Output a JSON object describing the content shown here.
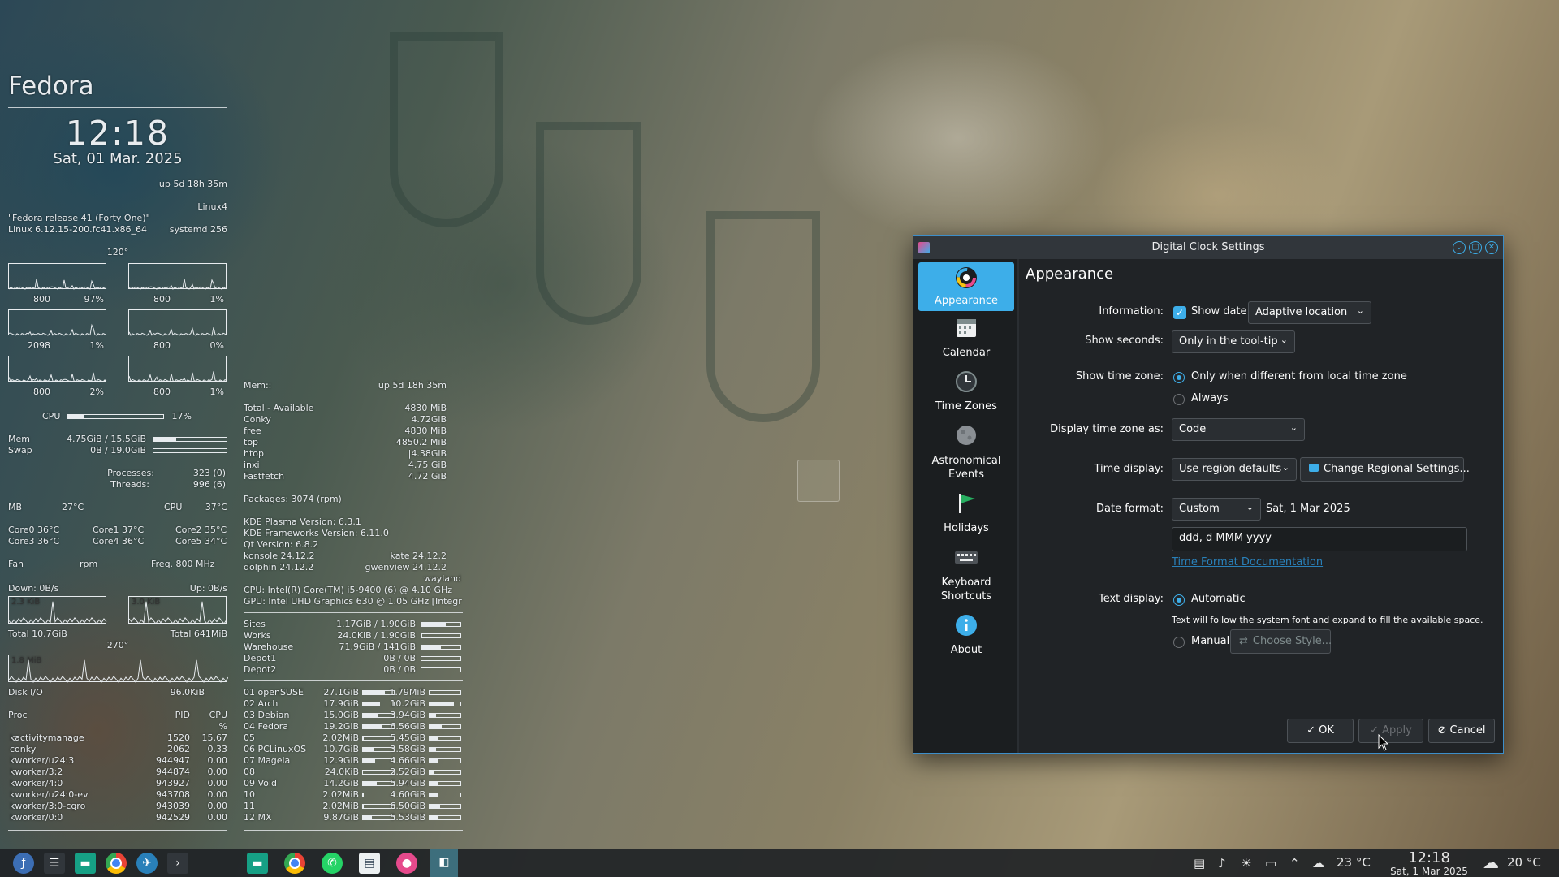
{
  "colors": {
    "accent": "#3daee9",
    "window_bg": "#202326",
    "sidebar_bg": "#1b1e20"
  },
  "conky_left": {
    "distro": "Fedora",
    "time": "12:18",
    "date": "Sat, 01 Mar. 2025",
    "uptime": "up  5d 18h 35m",
    "kernel_name": "Linux4",
    "release": "\"Fedora release 41 (Forty One)\"",
    "kernel": "Linux 6.12.15-200.fc41.x86_64",
    "systemd": "systemd 256",
    "temp_top": "120°",
    "cpu_graphs": [
      {
        "freq": "800",
        "pct": "97%"
      },
      {
        "freq": "800",
        "pct": "1%"
      },
      {
        "freq": "2098",
        "pct": "1%"
      },
      {
        "freq": "800",
        "pct": "0%"
      },
      {
        "freq": "800",
        "pct": "2%"
      },
      {
        "freq": "800",
        "pct": "1%"
      }
    ],
    "cpu_label": "CPU",
    "cpu_pct": "17%",
    "cpu_fill": 0.17,
    "mem_label": "Mem",
    "mem_val": "4.75GiB / 15.5GiB",
    "mem_fill": 0.31,
    "swap_label": "Swap",
    "swap_val": "0B / 19.0GiB",
    "swap_fill": 0.0,
    "processes_label": "Processes:",
    "processes_val": "323 (0)",
    "threads_label": "Threads:",
    "threads_val": "996 (6)",
    "mb_label": "MB",
    "mb_temp": "27°C",
    "cpu_temp_label": "CPU",
    "cpu_temp": "37°C",
    "cores": [
      "Core0  36°C",
      "Core1 37°C",
      "Core2 35°C",
      "Core3  36°C",
      "Core4 36°C",
      "Core5 34°C"
    ],
    "fan_label": "Fan",
    "fan_val": "rpm",
    "freq_label": "Freq.  800   MHz",
    "down_label": "Down: 0B/s",
    "up_label": "Up: 0B/s",
    "down_graph": "2.3 KiB",
    "up_graph": "3.0 KiB",
    "total_down": "Total 10.7GiB",
    "total_up": "Total 641MiB",
    "temp_mid": "270°",
    "disk_graph": "1.8 MiB",
    "disk_label": "Disk I/O",
    "disk_val": "96.0KiB",
    "proc_header": {
      "name": "Proc",
      "pid": "PID",
      "cpu": "CPU",
      "pct": "%"
    },
    "procs": [
      {
        "name": "kactivitymanage",
        "pid": "1520",
        "cpu": "15.67"
      },
      {
        "name": "conky",
        "pid": "2062",
        "cpu": "0.33"
      },
      {
        "name": "kworker/u24:3",
        "pid": "944947",
        "cpu": "0.00"
      },
      {
        "name": "kworker/3:2",
        "pid": "944874",
        "cpu": "0.00"
      },
      {
        "name": "kworker/4:0",
        "pid": "943927",
        "cpu": "0.00"
      },
      {
        "name": "kworker/u24:0-ev",
        "pid": "943708",
        "cpu": "0.00"
      },
      {
        "name": "kworker/3:0-cgro",
        "pid": "943039",
        "cpu": "0.00"
      },
      {
        "name": "kworker/0:0",
        "pid": "942529",
        "cpu": "0.00"
      }
    ]
  },
  "conky_right": {
    "mem_header": "Mem::",
    "uptime": "up  5d 18h 35m",
    "mem_rows": [
      {
        "name": "Total - Available",
        "val": "4830 MiB"
      },
      {
        "name": "Conky",
        "val": "4.72GiB"
      },
      {
        "name": "free",
        "val": "4830    MiB"
      },
      {
        "name": "top",
        "val": "4850.2  MiB"
      },
      {
        "name": "htop",
        "val": "|4.38GiB"
      },
      {
        "name": "inxi",
        "val": "4.75 GiB"
      },
      {
        "name": "Fastfetch",
        "val": "4.72 GiB"
      }
    ],
    "packages": "Packages: 3074 (rpm)",
    "versions": [
      {
        "l": "KDE Plasma Version: 6.3.1",
        "r": ""
      },
      {
        "l": "KDE Frameworks Version: 6.11.0",
        "r": ""
      },
      {
        "l": "Qt Version: 6.8.2",
        "r": ""
      },
      {
        "l": "konsole 24.12.2",
        "r": "kate 24.12.2"
      },
      {
        "l": "dolphin 24.12.2",
        "r": "gwenview 24.12.2"
      }
    ],
    "session": "wayland",
    "cpu_info": "CPU: Intel(R) Core(TM) i5-9400 (6) @ 4.10 GHz",
    "gpu_info": "GPU: Intel UHD Graphics 630 @ 1.05 GHz [Integr",
    "disks": [
      {
        "name": "Sites",
        "val": "1.17GiB  /  1.90GiB",
        "fill": 0.62
      },
      {
        "name": "Works",
        "val": "24.0KiB  /  1.90GiB",
        "fill": 0.02
      },
      {
        "name": "Warehouse",
        "val": "71.9GiB  /  141GiB",
        "fill": 0.51
      },
      {
        "name": "Depot1",
        "val": "0B  /   0B",
        "fill": 0.0
      },
      {
        "name": "Depot2",
        "val": "0B  /   0B",
        "fill": 0.0
      }
    ],
    "distros": [
      {
        "name": "01 openSUSE",
        "a": "27.1GiB",
        "af": 0.7,
        "b": "1.79MiB",
        "bf": 0.02
      },
      {
        "name": "02 Arch",
        "a": "17.9GiB",
        "af": 0.55,
        "b": "10.2GiB",
        "bf": 0.8
      },
      {
        "name": "03 Debian",
        "a": "15.0GiB",
        "af": 0.5,
        "b": "3.94GiB",
        "bf": 0.2
      },
      {
        "name": "04 Fedora",
        "a": "19.2GiB",
        "af": 0.6,
        "b": "6.56GiB",
        "bf": 0.4
      },
      {
        "name": "05",
        "a": "2.02MiB",
        "af": 0.02,
        "b": "5.45GiB",
        "bf": 0.3
      },
      {
        "name": "06 PCLinuxOS",
        "a": "10.7GiB",
        "af": 0.35,
        "b": "3.58GiB",
        "bf": 0.2
      },
      {
        "name": "07 Mageia",
        "a": "12.9GiB",
        "af": 0.4,
        "b": "4.66GiB",
        "bf": 0.25
      },
      {
        "name": "08",
        "a": "24.0KiB",
        "af": 0.0,
        "b": "2.52GiB",
        "bf": 0.12
      },
      {
        "name": "09 Void",
        "a": "14.2GiB",
        "af": 0.45,
        "b": "5.94GiB",
        "bf": 0.3
      },
      {
        "name": "10",
        "a": "2.02MiB",
        "af": 0.02,
        "b": "4.60GiB",
        "bf": 0.25
      },
      {
        "name": "11",
        "a": "2.02MiB",
        "af": 0.02,
        "b": "6.50GiB",
        "bf": 0.35
      },
      {
        "name": "12 MX",
        "a": "9.87GiB",
        "af": 0.3,
        "b": "5.53GiB",
        "bf": 0.28
      }
    ]
  },
  "dialog": {
    "title": "Digital Clock Settings",
    "sidebar": [
      {
        "label": "Appearance",
        "icon": "appearance-icon"
      },
      {
        "label": "Calendar",
        "icon": "calendar-icon"
      },
      {
        "label": "Time Zones",
        "icon": "clock-icon"
      },
      {
        "label": "Astronomical Events",
        "icon": "moon-icon"
      },
      {
        "label": "Holidays",
        "icon": "flag-icon"
      },
      {
        "label": "Keyboard Shortcuts",
        "icon": "keyboard-icon"
      },
      {
        "label": "About",
        "icon": "info-icon"
      }
    ],
    "page_title": "Appearance",
    "information_label": "Information:",
    "show_date_label": "Show date",
    "show_date_checked": true,
    "date_location": "Adaptive location",
    "show_seconds_label": "Show seconds:",
    "show_seconds_value": "Only in the tool-tip",
    "show_tz_label": "Show time zone:",
    "tz_opt1": "Only when different from local time zone",
    "tz_opt2": "Always",
    "display_tz_label": "Display time zone as:",
    "display_tz_value": "Code",
    "time_display_label": "Time display:",
    "time_display_value": "Use region defaults",
    "change_regional_button": "Change Regional Settings...",
    "date_format_label": "Date format:",
    "date_format_value": "Custom",
    "date_preview": "Sat, 1 Mar 2025",
    "custom_format": "ddd, d MMM yyyy",
    "doc_link": "Time Format Documentation",
    "text_display_label": "Text display:",
    "automatic_label": "Automatic",
    "automatic_hint": "Text will follow the system font and expand to fill the available space.",
    "manual_label": "Manual",
    "choose_style_button": "Choose Style...",
    "ok_button": "OK",
    "apply_button": "Apply",
    "cancel_button": "Cancel"
  },
  "taskbar": {
    "left_icons": [
      "fedora-icon",
      "settings-icon",
      "files-icon",
      "chrome-icon",
      "browser-icon",
      "terminal-icon"
    ],
    "mid_icons": [
      "files-icon",
      "chrome-icon",
      "whatsapp-icon",
      "reader-icon",
      "app-icon",
      "clock-app-icon"
    ],
    "temp1": "23 °C",
    "clock_time": "12:18",
    "clock_date": "Sat, 1 Mar 2025",
    "weather": "20 °C"
  }
}
